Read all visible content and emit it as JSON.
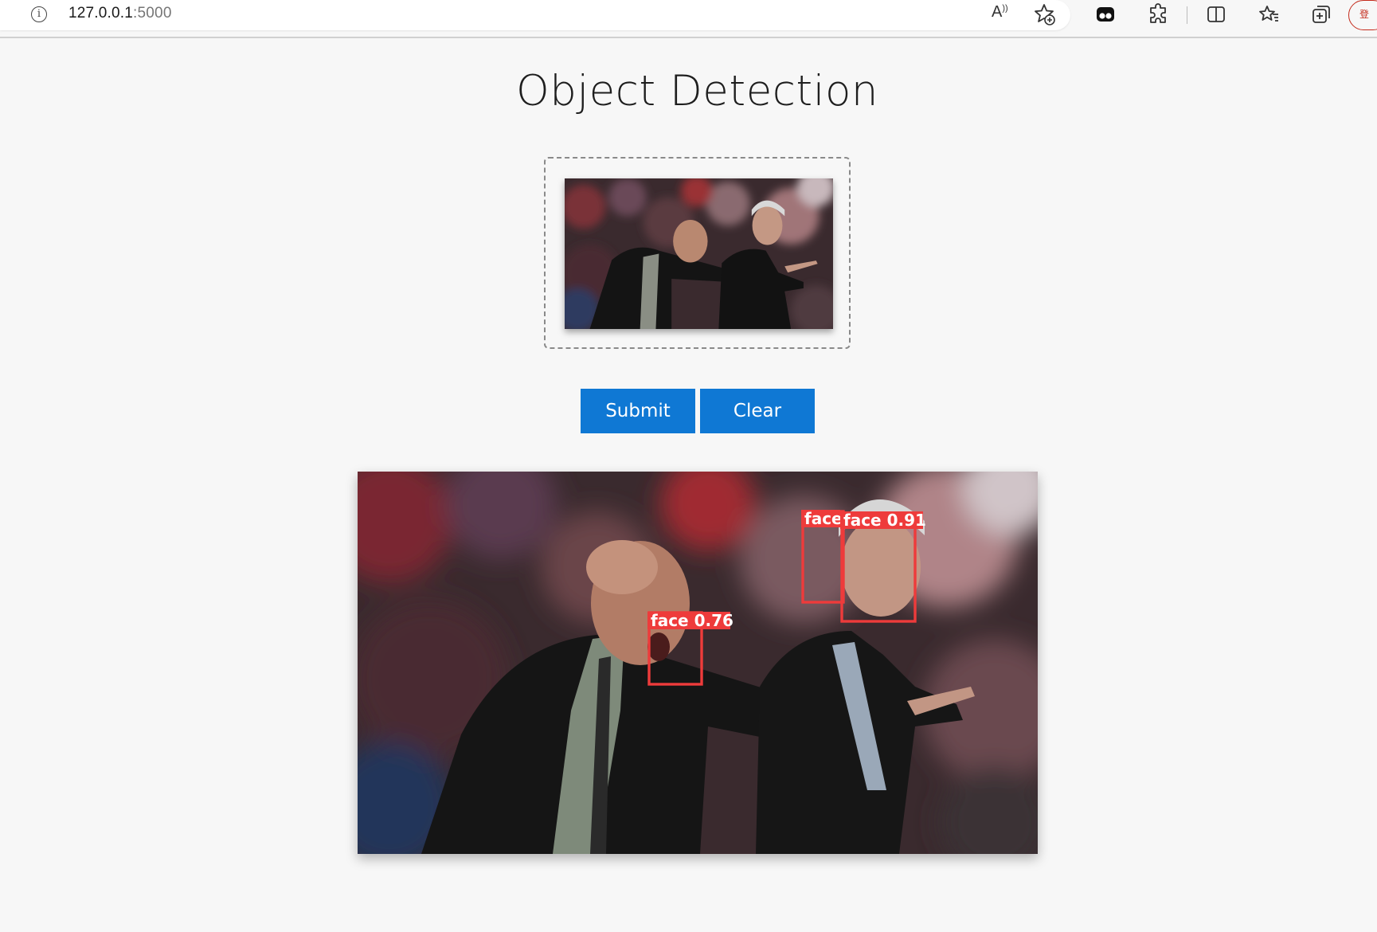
{
  "browser": {
    "url_host": "127.0.0.1",
    "url_port": ":5000",
    "info_icon_glyph": "i",
    "read_aloud_glyph": "A",
    "profile_glyph": "登"
  },
  "page": {
    "title": "Object Detection"
  },
  "actions": {
    "submit_label": "Submit",
    "clear_label": "Clear"
  },
  "detections": [
    {
      "label": "face 0.76"
    },
    {
      "label": "face"
    },
    {
      "label": "face 0.91"
    }
  ],
  "colors": {
    "accent": "#0f78d4",
    "detection_box": "#ee3b3b",
    "page_background": "#f7f7f7"
  }
}
